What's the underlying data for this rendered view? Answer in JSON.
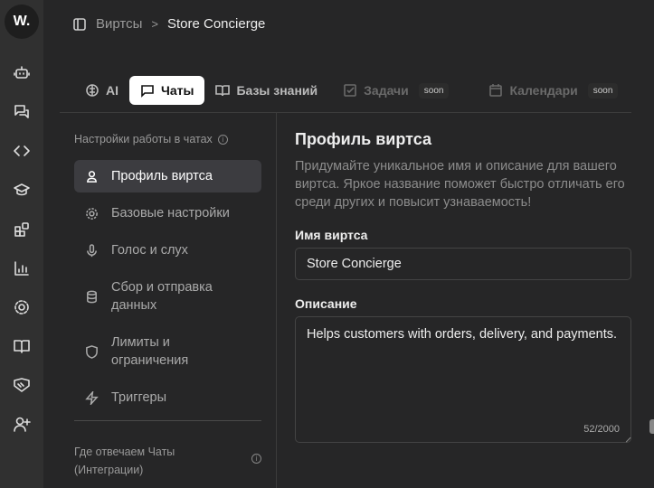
{
  "logo": "W.",
  "breadcrumb": {
    "parent": "Виртсы",
    "current": "Store Concierge"
  },
  "tabs": [
    {
      "label": "AI"
    },
    {
      "label": "Чаты"
    },
    {
      "label": "Базы знаний"
    },
    {
      "label": "Задачи",
      "badge": "soon"
    },
    {
      "label": "Календари",
      "badge": "soon"
    }
  ],
  "settings": {
    "title": "Настройки работы в чатах",
    "items": [
      {
        "label": "Профиль виртса",
        "icon": "user-icon"
      },
      {
        "label": "Базовые настройки",
        "icon": "gear-icon"
      },
      {
        "label": "Голос и слух",
        "icon": "mic-icon"
      },
      {
        "label": "Сбор и отправка данных",
        "icon": "database-icon"
      },
      {
        "label": "Лимиты и ограничения",
        "icon": "shield-icon"
      },
      {
        "label": "Триггеры",
        "icon": "zap-icon"
      }
    ],
    "where": "Где отвечаем Чаты (Интеграции)"
  },
  "profile": {
    "title": "Профиль виртса",
    "description": "Придумайте уникальное имя и описание для вашего виртса. Яркое название поможет быстро отличать его среди других и повысит узнаваемость!",
    "name_label": "Имя виртса",
    "name_value": "Store Concierge",
    "desc_label": "Описание",
    "desc_value": "Helps customers with orders, delivery, and payments.",
    "desc_counter": "52/2000"
  }
}
